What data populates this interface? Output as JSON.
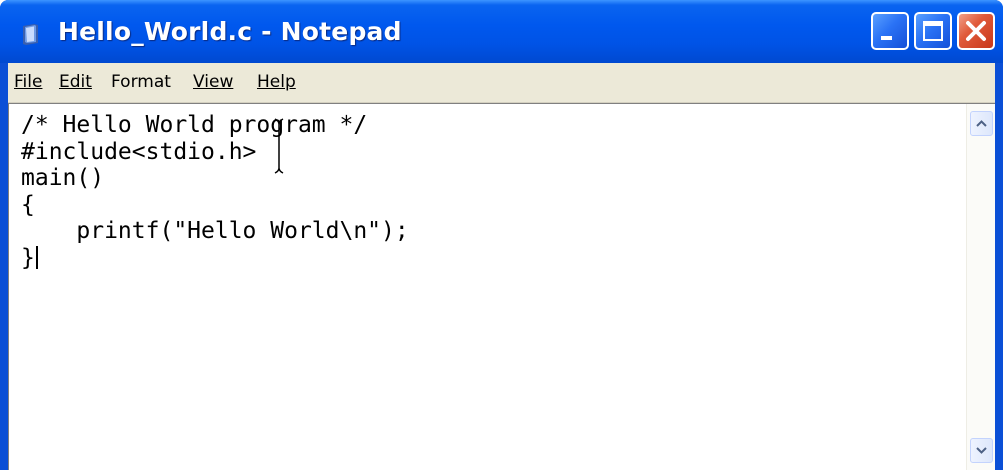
{
  "window": {
    "title": "Hello_World.c - Notepad"
  },
  "menu": {
    "file": "File",
    "edit": "Edit",
    "format": "Format",
    "view": "View",
    "help": "Help"
  },
  "editor": {
    "content": "/* Hello World program */\n#include<stdio.h>\nmain()\n{\n    printf(\"Hello World\\n\");\n}"
  },
  "icons": {
    "app": "notepad-icon",
    "minimize": "minimize-icon",
    "maximize": "maximize-icon",
    "close": "close-icon",
    "scroll_up": "chevron-up-icon",
    "scroll_down": "chevron-down-icon"
  },
  "colors": {
    "titlebar": "#0058ee",
    "close_button": "#e05a3a",
    "menubar": "#ece9d8"
  }
}
